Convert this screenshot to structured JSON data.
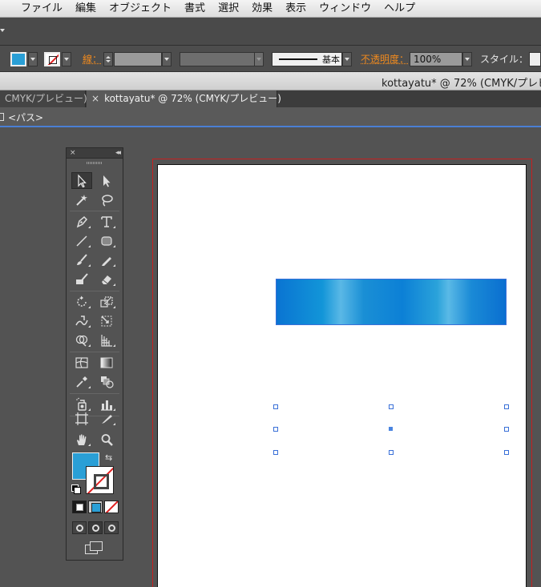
{
  "menubar": {
    "items": [
      "ファイル",
      "編集",
      "オブジェクト",
      "書式",
      "選択",
      "効果",
      "表示",
      "ウィンドウ",
      "ヘルプ"
    ]
  },
  "controlbar": {
    "stroke_label": "線：",
    "stroke_profile": "基本",
    "opacity_label": "不透明度：",
    "opacity_value": "100%",
    "style_label": "スタイル："
  },
  "window": {
    "title": "kottayatu* @ 72% (CMYK/プレビ"
  },
  "tabs": [
    {
      "label": "CMYK/プレビュー)"
    },
    {
      "close": "×",
      "label": "kottayatu* @ 72% (CMYK/プレビュー)"
    }
  ],
  "breadcrumb": {
    "label": "<パス>"
  },
  "colors": {
    "fill": "#2a9fd6",
    "stroke": "none",
    "artboard_border": "#c62020",
    "selection": "#3a70d8"
  },
  "tools_panel": {
    "close": "×",
    "collapse": "◂◂",
    "tools": [
      "selection-tool",
      "direct-selection-tool",
      "magic-wand-tool",
      "lasso-tool",
      "pen-tool",
      "type-tool",
      "line-segment-tool",
      "rounded-rectangle-tool",
      "paintbrush-tool",
      "pencil-tool",
      "blob-brush-tool",
      "eraser-tool",
      "rotate-tool",
      "scale-tool",
      "warp-tool",
      "free-transform-tool",
      "shape-builder-tool",
      "perspective-grid-tool",
      "mesh-tool",
      "gradient-tool",
      "eyedropper-tool",
      "blend-tool",
      "symbol-sprayer-tool",
      "column-graph-tool",
      "artboard-tool",
      "slice-tool",
      "hand-tool",
      "zoom-tool"
    ],
    "swap": "⇆"
  }
}
